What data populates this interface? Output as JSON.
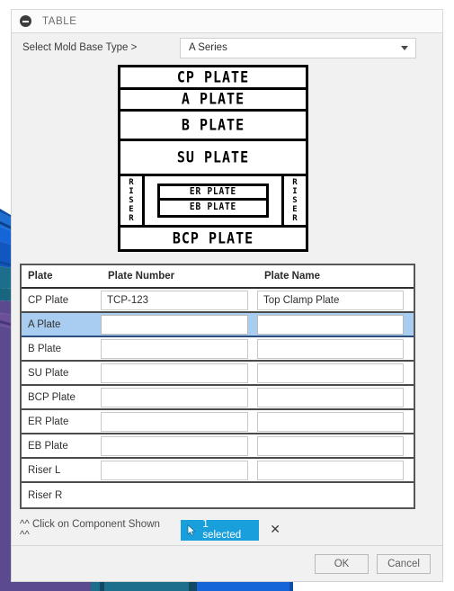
{
  "panel": {
    "section_title": "TABLE",
    "collapse_icon": "minus-circle-icon"
  },
  "moldbase": {
    "label": "Select Mold Base Type >",
    "selected": "A Series",
    "caret_icon": "chevron-down-icon"
  },
  "diagram": {
    "rows": [
      {
        "label": "CP PLATE"
      },
      {
        "label": "A PLATE"
      },
      {
        "label": "B PLATE"
      },
      {
        "label": "SU PLATE"
      }
    ],
    "riser_left": "R\nI\nS\nE\nR",
    "riser_right": "R\nI\nS\nE\nR",
    "riser_left_letters": [
      "R",
      "I",
      "S",
      "E",
      "R"
    ],
    "riser_right_letters": [
      "R",
      "I",
      "S",
      "E",
      "R"
    ],
    "er_plate": "ER PLATE",
    "eb_plate": "EB PLATE",
    "bcp_plate": "BCP PLATE"
  },
  "table": {
    "headers": [
      "Plate",
      "Plate Number",
      "Plate Name"
    ],
    "rows": [
      {
        "plate": "CP Plate",
        "number": "TCP-123",
        "name": "Top Clamp Plate",
        "has_inputs": true,
        "selected": false
      },
      {
        "plate": "A Plate",
        "number": "",
        "name": "",
        "has_inputs": true,
        "selected": true
      },
      {
        "plate": "B Plate",
        "number": "",
        "name": "",
        "has_inputs": true,
        "selected": false
      },
      {
        "plate": "SU Plate",
        "number": "",
        "name": "",
        "has_inputs": true,
        "selected": false
      },
      {
        "plate": "BCP Plate",
        "number": "",
        "name": "",
        "has_inputs": true,
        "selected": false
      },
      {
        "plate": "ER Plate",
        "number": "",
        "name": "",
        "has_inputs": true,
        "selected": false
      },
      {
        "plate": "EB Plate",
        "number": "",
        "name": "",
        "has_inputs": true,
        "selected": false
      },
      {
        "plate": "Riser L",
        "number": "",
        "name": "",
        "has_inputs": true,
        "selected": false
      },
      {
        "plate": "Riser R",
        "number": "",
        "name": "",
        "has_inputs": false,
        "selected": false
      }
    ]
  },
  "component_bar": {
    "hint": "^^ Click on Component Shown ^^",
    "selected_label": "1 selected",
    "cursor_icon": "cursor-arrow-icon",
    "clear_icon": "close-icon",
    "clear_glyph": "✕",
    "accent_color": "#189fdc"
  },
  "footer": {
    "ok_label": "OK",
    "cancel_label": "Cancel"
  },
  "background": {
    "colors": {
      "purple": "#5c4a8f",
      "teal": "#1d6e8c",
      "blue": "#1565d8",
      "bright_blue": "#2272e8"
    }
  }
}
